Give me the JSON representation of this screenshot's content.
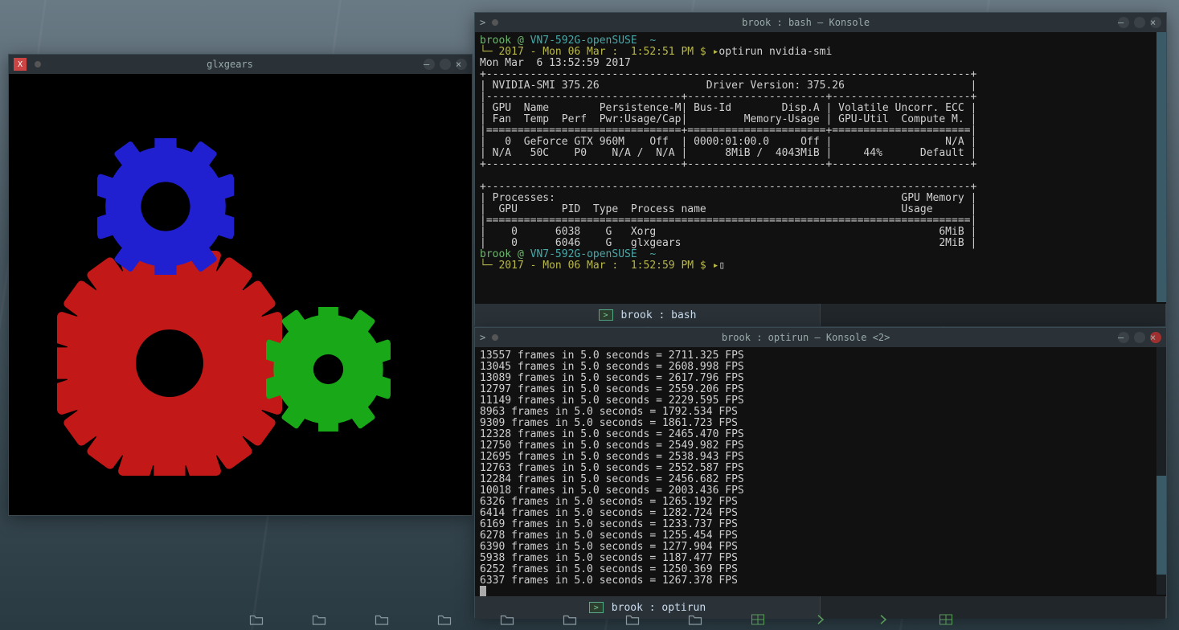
{
  "glxgears": {
    "title": "glxgears"
  },
  "konsole1": {
    "title": "brook : bash — Konsole",
    "prompt1_user": "brook",
    "prompt1_at": " @ ",
    "prompt1_host": "VN7-592G-openSUSE",
    "prompt1_tilde": "  ~",
    "prompt1_line2": "└─ 2017 - Mon 06 Mar :  1:52:51 PM $ ▸",
    "cmd1": "optirun nvidia-smi",
    "smi_out": "Mon Mar  6 13:52:59 2017       \n+-----------------------------------------------------------------------------+\n| NVIDIA-SMI 375.26                 Driver Version: 375.26                    |\n|-------------------------------+----------------------+----------------------+\n| GPU  Name        Persistence-M| Bus-Id        Disp.A | Volatile Uncorr. ECC |\n| Fan  Temp  Perf  Pwr:Usage/Cap|         Memory-Usage | GPU-Util  Compute M. |\n|===============================+======================+======================|\n|   0  GeForce GTX 960M    Off  | 0000:01:00.0     Off |                  N/A |\n| N/A   50C    P0    N/A /  N/A |      8MiB /  4043MiB |     44%      Default |\n+-------------------------------+----------------------+----------------------+\n                                                                               \n+-----------------------------------------------------------------------------+\n| Processes:                                                       GPU Memory |\n|  GPU       PID  Type  Process name                               Usage      |\n|=============================================================================|\n|    0      6038    G   Xorg                                             6MiB |\n|    0      6046    G   glxgears                                         2MiB |",
    "prompt2_line2": "└─ 2017 - Mon 06 Mar :  1:52:59 PM $ ▸",
    "cursor": "▯",
    "tab_label": "brook : bash"
  },
  "konsole2": {
    "title": "brook : optirun — Konsole <2>",
    "fps_out": "13557 frames in 5.0 seconds = 2711.325 FPS\n13045 frames in 5.0 seconds = 2608.998 FPS\n13089 frames in 5.0 seconds = 2617.796 FPS\n12797 frames in 5.0 seconds = 2559.206 FPS\n11149 frames in 5.0 seconds = 2229.595 FPS\n8963 frames in 5.0 seconds = 1792.534 FPS\n9309 frames in 5.0 seconds = 1861.723 FPS\n12328 frames in 5.0 seconds = 2465.470 FPS\n12750 frames in 5.0 seconds = 2549.982 FPS\n12695 frames in 5.0 seconds = 2538.943 FPS\n12763 frames in 5.0 seconds = 2552.587 FPS\n12284 frames in 5.0 seconds = 2456.682 FPS\n10018 frames in 5.0 seconds = 2003.436 FPS\n6326 frames in 5.0 seconds = 1265.192 FPS\n6414 frames in 5.0 seconds = 1282.724 FPS\n6169 frames in 5.0 seconds = 1233.737 FPS\n6278 frames in 5.0 seconds = 1255.454 FPS\n6390 frames in 5.0 seconds = 1277.904 FPS\n5938 frames in 5.0 seconds = 1187.477 FPS\n6252 frames in 5.0 seconds = 1250.369 FPS\n6337 frames in 5.0 seconds = 1267.378 FPS",
    "tab_label": "brook : optirun"
  }
}
